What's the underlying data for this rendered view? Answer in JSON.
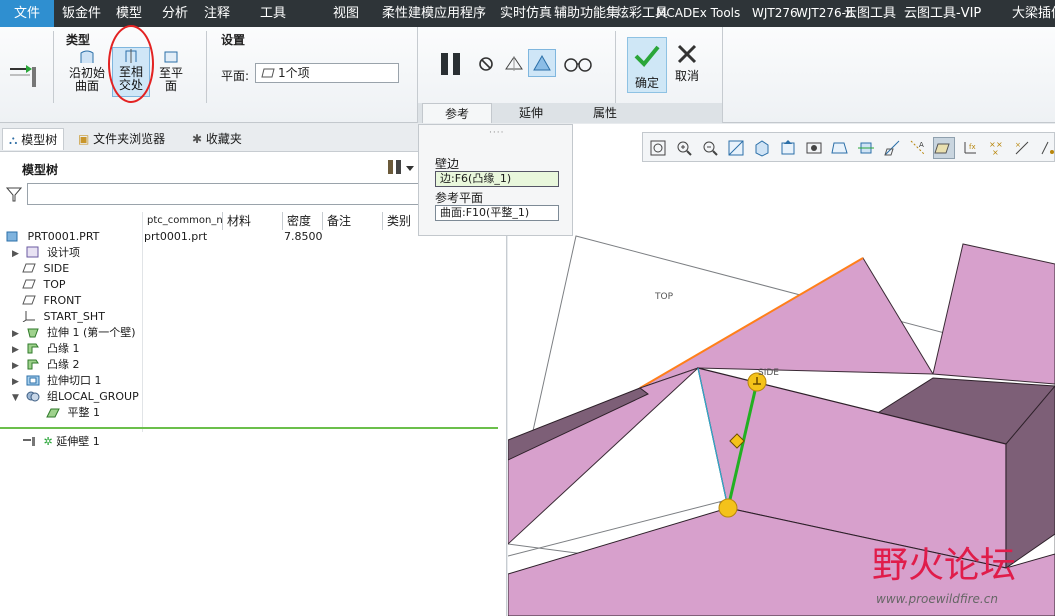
{
  "menu": {
    "file": "文件",
    "items": [
      "钣金件",
      "模型",
      "分析",
      "注释",
      "工具",
      "视图",
      "柔性建模",
      "应用程序",
      "实时仿真",
      "辅助功能集",
      "炫彩工具",
      "MCADEx Tools",
      "WJT276",
      "WJT276-II",
      "云图工具",
      "云图工具-VIP",
      "大梁插件"
    ]
  },
  "ribbon": {
    "type_group": "类型",
    "settings_group": "设置",
    "btn_initial": [
      "沿初始",
      "曲面"
    ],
    "btn_to_next": [
      "至相",
      "交处"
    ],
    "btn_to_plane": [
      "至平",
      "面"
    ],
    "plane_label": "平面:",
    "plane_value": "1个项",
    "tabs": [
      "参考",
      "延伸",
      "属性"
    ],
    "ok": "确定",
    "cancel": "取消",
    "colors": {
      "accent": "#2f8fd0",
      "annotation_ring": "#e32222",
      "ok_check": "#2aa639"
    }
  },
  "panel": {
    "tabs": [
      "模型树",
      "文件夹浏览器",
      "收藏夹"
    ],
    "title": "模型树",
    "columns": [
      "ptc_common_n",
      "材料",
      "密度",
      "备注",
      "类别"
    ],
    "row0": {
      "name": "PRT0001.PRT",
      "common": "prt0001.prt",
      "density": "7.8500"
    },
    "items": [
      {
        "label": "设计项",
        "twisty": "▶"
      },
      {
        "label": "SIDE",
        "twisty": ""
      },
      {
        "label": "TOP",
        "twisty": ""
      },
      {
        "label": "FRONT",
        "twisty": ""
      },
      {
        "label": "START_SHT",
        "twisty": ""
      },
      {
        "label": "拉伸 1 (第一个壁)",
        "twisty": "▶"
      },
      {
        "label": "凸缘 1",
        "twisty": "▶"
      },
      {
        "label": "凸缘 2",
        "twisty": "▶"
      },
      {
        "label": "拉伸切口 1",
        "twisty": "▶"
      },
      {
        "label": "组LOCAL_GROUP",
        "twisty": "▼"
      },
      {
        "label": "平整 1",
        "twisty": ""
      }
    ],
    "insert": "延伸壁 1"
  },
  "popup": {
    "edge_label": "壁边",
    "edge_value": "边:F6(凸缘_1)",
    "ref_label": "参考平面",
    "ref_value": "曲面:F10(平整_1)"
  },
  "model": {
    "label_top": "TOP",
    "label_side": "SIDE",
    "face_color": "#d7a0cc",
    "edge_highlight": "#ff7f1a",
    "handle_color": "#f4c21a",
    "line_green": "#22b022"
  },
  "watermark": {
    "title": "野火论坛",
    "url": "www.proewildfire.cn"
  }
}
